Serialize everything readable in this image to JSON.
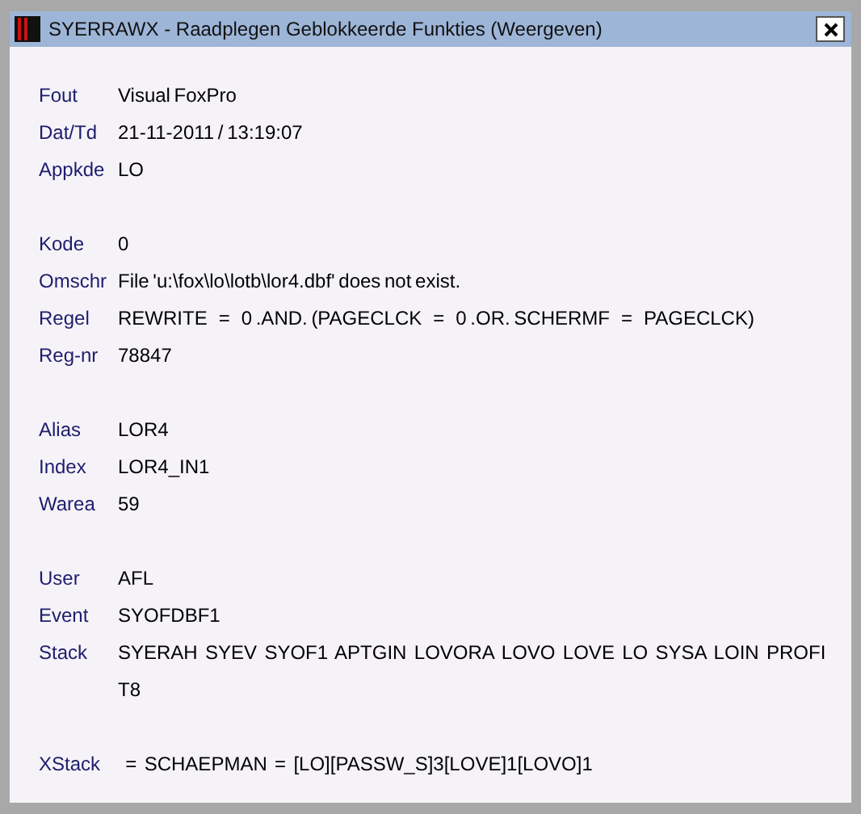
{
  "window": {
    "title": "SYERRAWX - Raadplegen Geblokkeerde Funkties (Weergeven)"
  },
  "groups": [
    {
      "rows": [
        {
          "label": "Fout",
          "lines": [
            "Visual FoxPro"
          ]
        },
        {
          "label": "Dat/Td",
          "lines": [
            "21-11-2011 / 13:19:07"
          ]
        },
        {
          "label": "Appkde",
          "lines": [
            "LO"
          ]
        }
      ]
    },
    {
      "rows": [
        {
          "label": "Kode",
          "lines": [
            "0"
          ]
        },
        {
          "label": "Omschr",
          "lines": [
            "File 'u:\\fox\\lo\\lotb\\lor4.dbf' does not exist."
          ]
        },
        {
          "label": "Regel",
          "lines": [
            "REWRITE   =   0 .AND. (PAGECLCK   =   0 .OR. SCHERMF   =   PAGECLCK)"
          ]
        },
        {
          "label": "Reg-nr",
          "lines": [
            "78847"
          ]
        }
      ]
    },
    {
      "rows": [
        {
          "label": "Alias",
          "lines": [
            "LOR4"
          ]
        },
        {
          "label": "Index",
          "lines": [
            "LOR4_IN1"
          ]
        },
        {
          "label": "Warea",
          "lines": [
            "59"
          ]
        }
      ]
    },
    {
      "rows": [
        {
          "label": "User",
          "lines": [
            "AFL"
          ]
        },
        {
          "label": "Event",
          "lines": [
            "SYOFDBF1"
          ]
        },
        {
          "label": "Stack",
          "lines": [
            "SYERAH  SYEV  SYOF1  APTGIN  LOVORA  LOVO  LOVE  LO  SYSA  LOIN  PROFI",
            "T8"
          ]
        }
      ]
    },
    {
      "rows": [
        {
          "label": "XStack",
          "lines": [
            "  =  SCHAEPMAN  =  [LO][PASSW_S]3[LOVE]1[LOVO]1"
          ]
        }
      ]
    }
  ]
}
